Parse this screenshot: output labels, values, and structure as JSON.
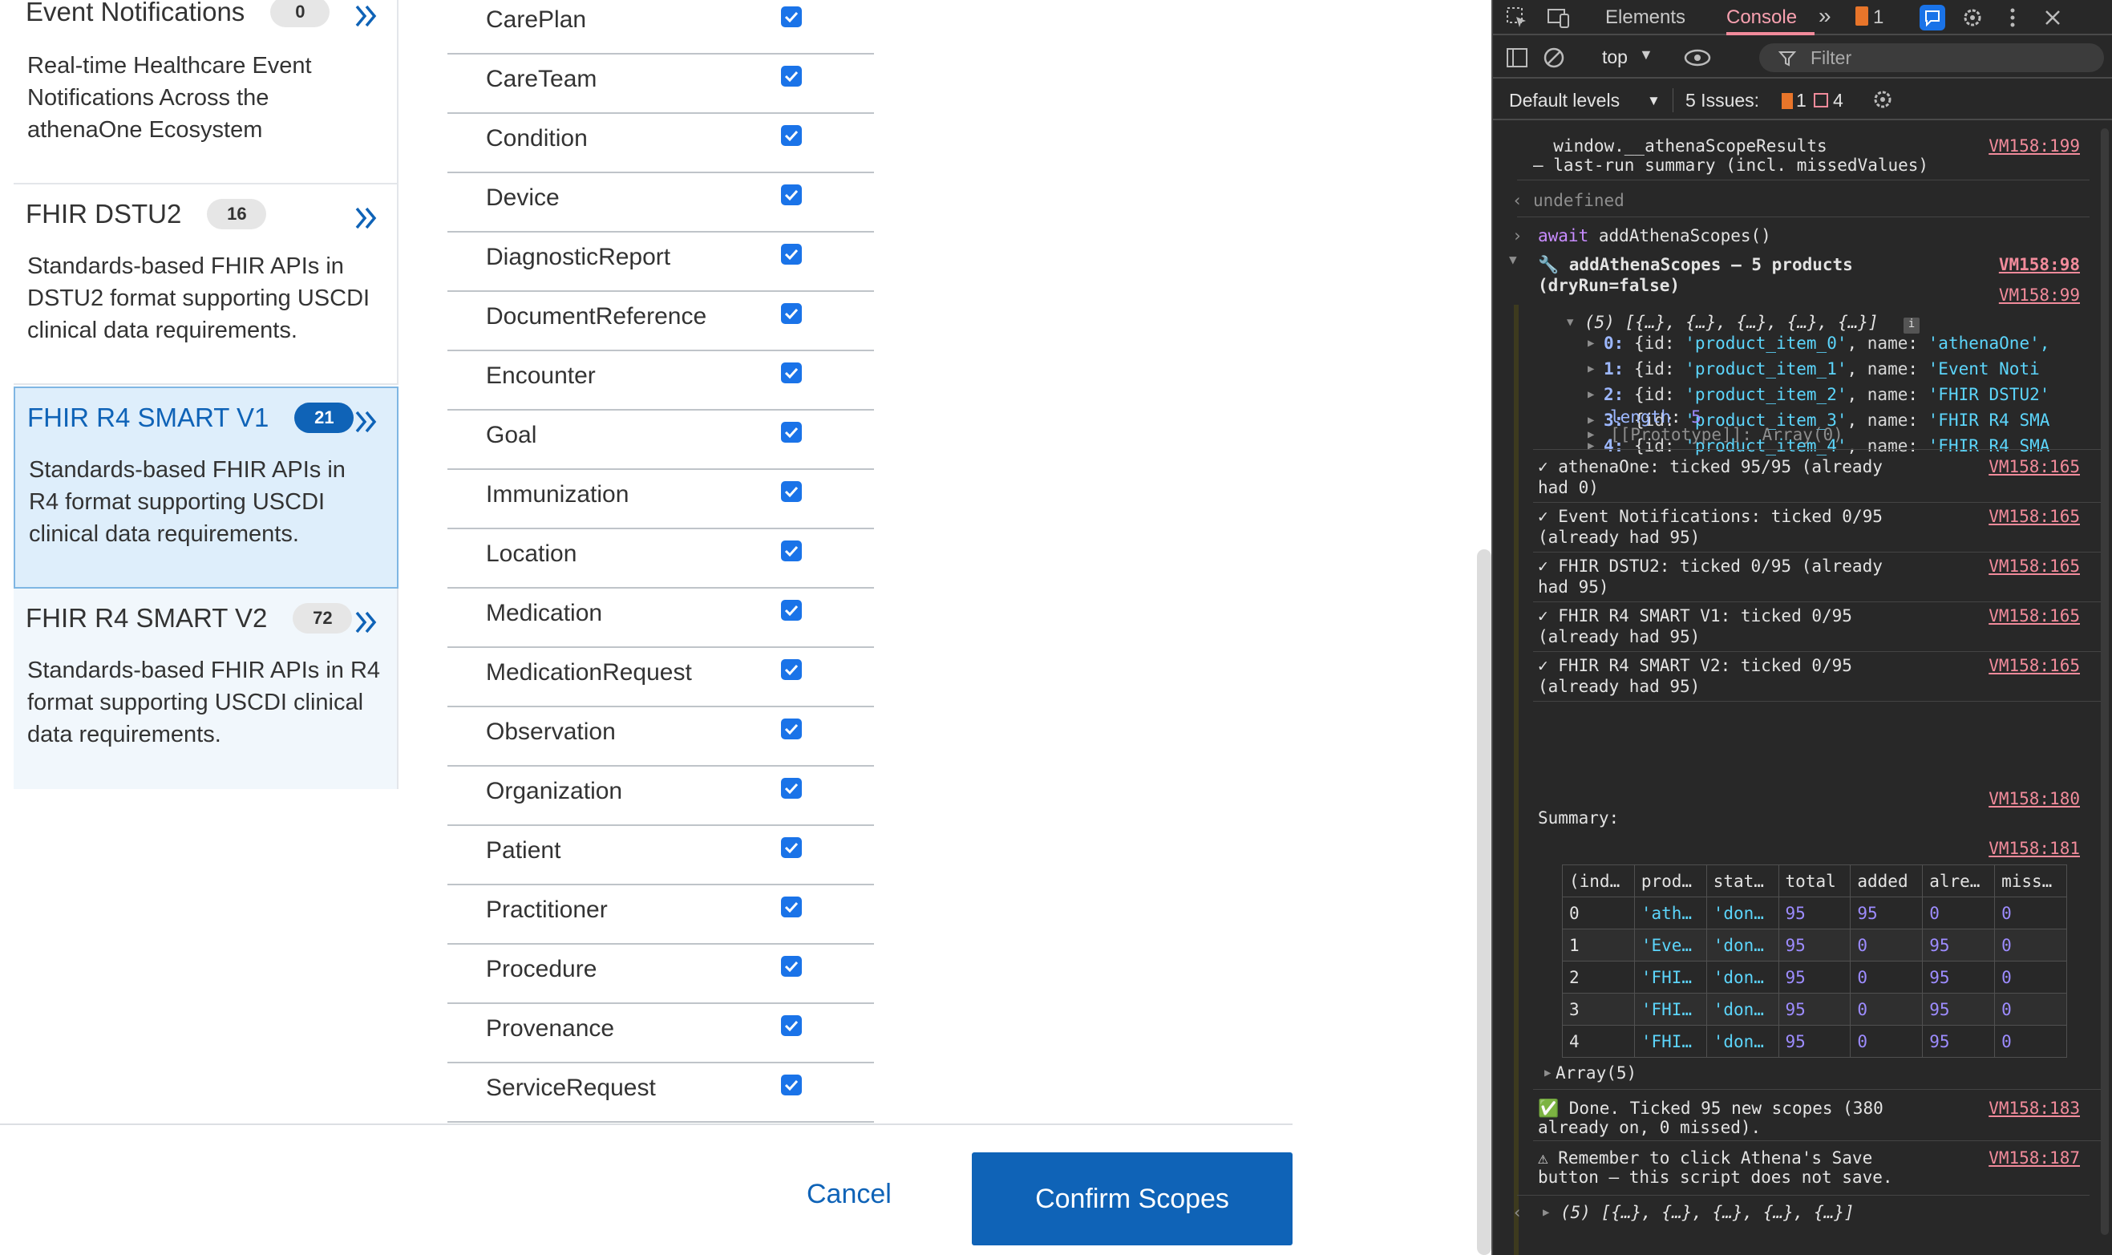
{
  "products": [
    {
      "name": "Event Notifications",
      "count": "0",
      "desc": "Real-time Healthcare Event Notifications Across the athenaOne Ecosystem",
      "state": "normal"
    },
    {
      "name": "FHIR DSTU2",
      "count": "16",
      "desc": "Standards-based FHIR APIs in DSTU2 format supporting USCDI clinical data requirements.",
      "state": "normal"
    },
    {
      "name": "FHIR R4 SMART V1",
      "count": "21",
      "desc": "Standards-based FHIR APIs in R4 format supporting USCDI clinical data requirements.",
      "state": "selected"
    },
    {
      "name": "FHIR R4 SMART V2",
      "count": "72",
      "desc": "Standards-based FHIR APIs in R4 format supporting USCDI clinical data requirements.",
      "state": "light"
    }
  ],
  "scopes": [
    {
      "label": "CarePlan",
      "checked": true
    },
    {
      "label": "CareTeam",
      "checked": true
    },
    {
      "label": "Condition",
      "checked": true
    },
    {
      "label": "Device",
      "checked": true
    },
    {
      "label": "DiagnosticReport",
      "checked": true
    },
    {
      "label": "DocumentReference",
      "checked": true
    },
    {
      "label": "Encounter",
      "checked": true
    },
    {
      "label": "Goal",
      "checked": true
    },
    {
      "label": "Immunization",
      "checked": true
    },
    {
      "label": "Location",
      "checked": true
    },
    {
      "label": "Medication",
      "checked": true
    },
    {
      "label": "MedicationRequest",
      "checked": true
    },
    {
      "label": "Observation",
      "checked": true
    },
    {
      "label": "Organization",
      "checked": true
    },
    {
      "label": "Patient",
      "checked": true
    },
    {
      "label": "Practitioner",
      "checked": true
    },
    {
      "label": "Procedure",
      "checked": true
    },
    {
      "label": "Provenance",
      "checked": true
    },
    {
      "label": "ServiceRequest",
      "checked": true
    }
  ],
  "footer": {
    "cancel": "Cancel",
    "confirm": "Confirm Scopes"
  },
  "devtools": {
    "tabs": {
      "elements": "Elements",
      "console": "Console",
      "more": "»",
      "warn_count": "1"
    },
    "toolbar": {
      "context": "top",
      "filter_placeholder": "Filter"
    },
    "levels": {
      "label": "Default levels",
      "issues_label": "5 Issues:",
      "issues_warn": "1",
      "issues_info": "4"
    },
    "console": {
      "line1": "  window.__athenaScopeResults",
      "line2": "– last-run summary (incl. missedValues)",
      "src_199": "VM158:199",
      "undefined": "undefined",
      "cmd_await": "await",
      "cmd_call": " addAthenaScopes()",
      "group_title1": "🔧 addAthenaScopes – 5 products",
      "group_title2": "(dryRun=false)",
      "src_98": "VM158:98",
      "src_99": "VM158:99",
      "array_head": "(5) [{…}, {…}, {…}, {…}, {…}]",
      "items": [
        {
          "idx": "0:",
          "id": "'product_item_0'",
          "name": "'athenaOne',"
        },
        {
          "idx": "1:",
          "id": "'product_item_1'",
          "name": "'Event Noti"
        },
        {
          "idx": "2:",
          "id": "'product_item_2'",
          "name": "'FHIR DSTU2'"
        },
        {
          "idx": "3:",
          "id": "'product_item_3'",
          "name": "'FHIR R4 SMA"
        },
        {
          "idx": "4:",
          "id": "'product_item_4'",
          "name": "'FHIR R4 SMA"
        }
      ],
      "length_key": "length",
      "length_val": "5",
      "proto": "[[Prototype]]: Array(0)",
      "ticks": [
        {
          "l1": "✓ athenaOne: ticked 95/95 (already",
          "l2": "had 0)",
          "src": "VM158:165"
        },
        {
          "l1": "✓ Event Notifications: ticked 0/95",
          "l2": "(already had 95)",
          "src": "VM158:165"
        },
        {
          "l1": "✓ FHIR DSTU2: ticked 0/95 (already",
          "l2": "had 95)",
          "src": "VM158:165"
        },
        {
          "l1": "✓ FHIR R4 SMART V1: ticked 0/95",
          "l2": "(already had 95)",
          "src": "VM158:165"
        },
        {
          "l1": "✓ FHIR R4 SMART V2: ticked 0/95",
          "l2": "(already had 95)",
          "src": "VM158:165"
        }
      ],
      "src_180": "VM158:180",
      "summary": "Summary:",
      "src_181": "VM158:181",
      "table_headers": [
        "(ind…",
        "prod…",
        "stat…",
        "total",
        "added",
        "alre…",
        "miss…"
      ],
      "table_rows": [
        [
          "0",
          "'ath…",
          "'don…",
          "95",
          "95",
          "0",
          "0"
        ],
        [
          "1",
          "'Eve…",
          "'don…",
          "95",
          "0",
          "95",
          "0"
        ],
        [
          "2",
          "'FHI…",
          "'don…",
          "95",
          "0",
          "95",
          "0"
        ],
        [
          "3",
          "'FHI…",
          "'don…",
          "95",
          "0",
          "95",
          "0"
        ],
        [
          "4",
          "'FHI…",
          "'don…",
          "95",
          "0",
          "95",
          "0"
        ]
      ],
      "array5": "Array(5)",
      "done1": "✅ Done. Ticked 95 new scopes (380",
      "done2": "already on, 0 missed).",
      "src_183": "VM158:183",
      "remind1": "⚠ Remember to click Athena's Save",
      "remind2": "button – this script does not save.",
      "src_187": "VM158:187",
      "result": "(5) [{…}, {…}, {…}, {…}, {…}]"
    }
  }
}
